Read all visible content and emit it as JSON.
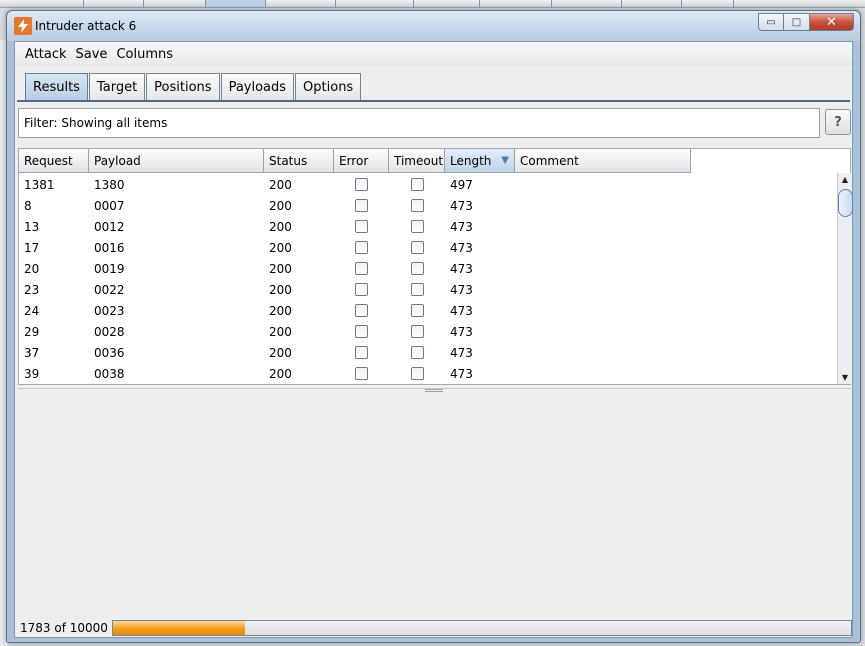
{
  "window": {
    "title": "Intruder attack 6",
    "controls": {
      "minimize": "▭",
      "maximize": "□",
      "close": "✕"
    }
  },
  "menu": [
    "Attack",
    "Save",
    "Columns"
  ],
  "tabs": [
    {
      "label": "Results",
      "active": true
    },
    {
      "label": "Target",
      "active": false
    },
    {
      "label": "Positions",
      "active": false
    },
    {
      "label": "Payloads",
      "active": false
    },
    {
      "label": "Options",
      "active": false
    }
  ],
  "filter": {
    "text": "Filter: Showing all items"
  },
  "help": {
    "label": "?"
  },
  "table": {
    "columns": [
      "Request",
      "Payload",
      "Status",
      "Error",
      "Timeout",
      "Length",
      "Comment"
    ],
    "sorted_column": "Length",
    "sort_direction": "descending",
    "rows": [
      {
        "request": "1381",
        "payload": "1380",
        "status": "200",
        "error": false,
        "timeout": false,
        "length": "497",
        "comment": ""
      },
      {
        "request": "8",
        "payload": "0007",
        "status": "200",
        "error": false,
        "timeout": false,
        "length": "473",
        "comment": ""
      },
      {
        "request": "13",
        "payload": "0012",
        "status": "200",
        "error": false,
        "timeout": false,
        "length": "473",
        "comment": ""
      },
      {
        "request": "17",
        "payload": "0016",
        "status": "200",
        "error": false,
        "timeout": false,
        "length": "473",
        "comment": ""
      },
      {
        "request": "20",
        "payload": "0019",
        "status": "200",
        "error": false,
        "timeout": false,
        "length": "473",
        "comment": ""
      },
      {
        "request": "23",
        "payload": "0022",
        "status": "200",
        "error": false,
        "timeout": false,
        "length": "473",
        "comment": ""
      },
      {
        "request": "24",
        "payload": "0023",
        "status": "200",
        "error": false,
        "timeout": false,
        "length": "473",
        "comment": ""
      },
      {
        "request": "29",
        "payload": "0028",
        "status": "200",
        "error": false,
        "timeout": false,
        "length": "473",
        "comment": ""
      },
      {
        "request": "37",
        "payload": "0036",
        "status": "200",
        "error": false,
        "timeout": false,
        "length": "473",
        "comment": ""
      },
      {
        "request": "39",
        "payload": "0038",
        "status": "200",
        "error": false,
        "timeout": false,
        "length": "473",
        "comment": ""
      }
    ]
  },
  "status": {
    "text": "1783 of 10000",
    "progress_fraction": 0.1783
  },
  "colors": {
    "accent": "#f39c1b",
    "active_tab": "#b7cde6",
    "window_frame": "#a9c1db"
  },
  "icons": {
    "app": "burp-lightning-icon",
    "sort": "sort-descending-icon"
  }
}
